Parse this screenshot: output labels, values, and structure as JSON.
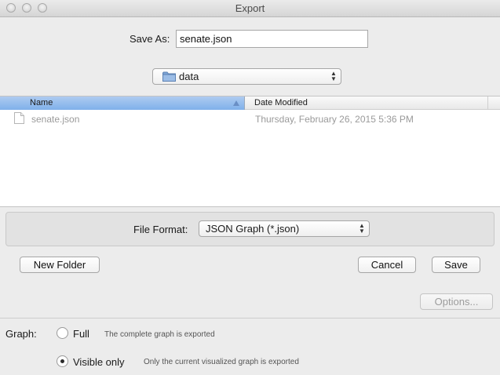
{
  "window": {
    "title": "Export"
  },
  "save_as": {
    "label": "Save As:",
    "value": "senate.json"
  },
  "location": {
    "folder": "data",
    "icon": "folder-icon"
  },
  "file_list": {
    "columns": [
      "Name",
      "Date Modified"
    ],
    "sort_column": "Name",
    "sort_direction": "ascending",
    "rows": [
      {
        "name": "senate.json",
        "date_modified": "Thursday, February 26, 2015 5:36 PM",
        "icon": "document-icon"
      }
    ]
  },
  "format": {
    "label": "File Format:",
    "selected": "JSON Graph (*.json)"
  },
  "buttons": {
    "new_folder": "New Folder",
    "cancel": "Cancel",
    "save": "Save",
    "options": "Options..."
  },
  "graph": {
    "label": "Graph:",
    "options": [
      {
        "label": "Full",
        "description": "The complete graph is exported",
        "selected": false
      },
      {
        "label": "Visible only",
        "description": "Only the current visualized graph is exported",
        "selected": true
      }
    ]
  }
}
